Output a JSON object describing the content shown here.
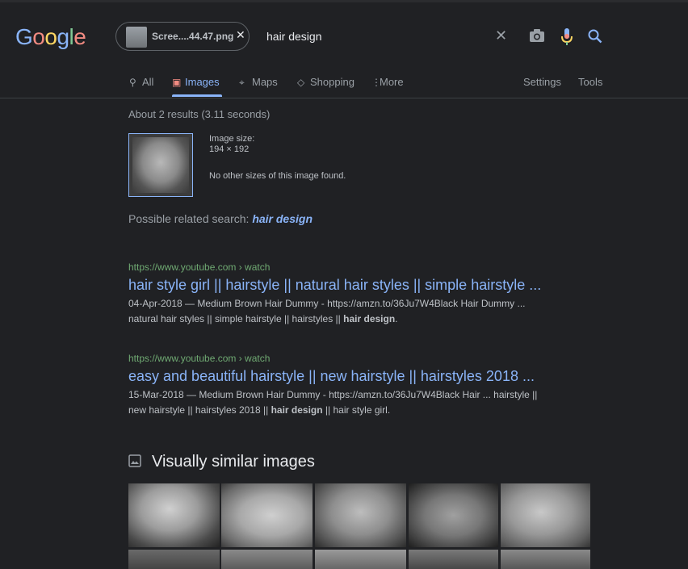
{
  "logo": {
    "letters": [
      "G",
      "o",
      "o",
      "g",
      "l",
      "e"
    ],
    "colors": [
      "#8ab4f8",
      "#f28b82",
      "#fdd663",
      "#8ab4f8",
      "#81c995",
      "#f28b82"
    ]
  },
  "search": {
    "chip_label": "Scree....44.47.png",
    "query": "hair design"
  },
  "tabs": [
    {
      "label": "All",
      "icon": "search-icon"
    },
    {
      "label": "Images",
      "icon": "image-icon"
    },
    {
      "label": "Maps",
      "icon": "map-pin-icon"
    },
    {
      "label": "Shopping",
      "icon": "tag-icon"
    },
    {
      "label": "More",
      "icon": "more-vert-icon"
    }
  ],
  "tools": {
    "settings": "Settings",
    "tools": "Tools"
  },
  "stats": "About 2 results (3.11 seconds)",
  "image_info": {
    "size_label": "Image size:",
    "size_value": "194 × 192",
    "no_other_sizes": "No other sizes of this image found."
  },
  "related": {
    "prefix": "Possible related search: ",
    "term": "hair design"
  },
  "results": [
    {
      "url": "https://www.youtube.com › watch",
      "title": "hair style girl || hairstyle || natural hair styles || simple hairstyle ...",
      "snippet_1": "04-Apr-2018 — Medium Brown Hair Dummy - https://amzn.to/36Ju7W4Black Hair Dummy ...",
      "snippet_2_pre": "natural hair styles || simple hairstyle || hairstyles || ",
      "snippet_2_bold": "hair design",
      "snippet_2_post": "."
    },
    {
      "url": "https://www.youtube.com › watch",
      "title": "easy and beautiful hairstyle || new hairstyle || hairstyles 2018 ...",
      "snippet_1": "15-Mar-2018 — Medium Brown Hair Dummy - https://amzn.to/36Ju7W4Black Hair ... hairstyle ||",
      "snippet_2_pre": "new hairstyle || hairstyles 2018 || ",
      "snippet_2_bold": "hair design",
      "snippet_2_post": " || hair style girl."
    }
  ],
  "visually_similar": {
    "title": "Visually similar images"
  }
}
